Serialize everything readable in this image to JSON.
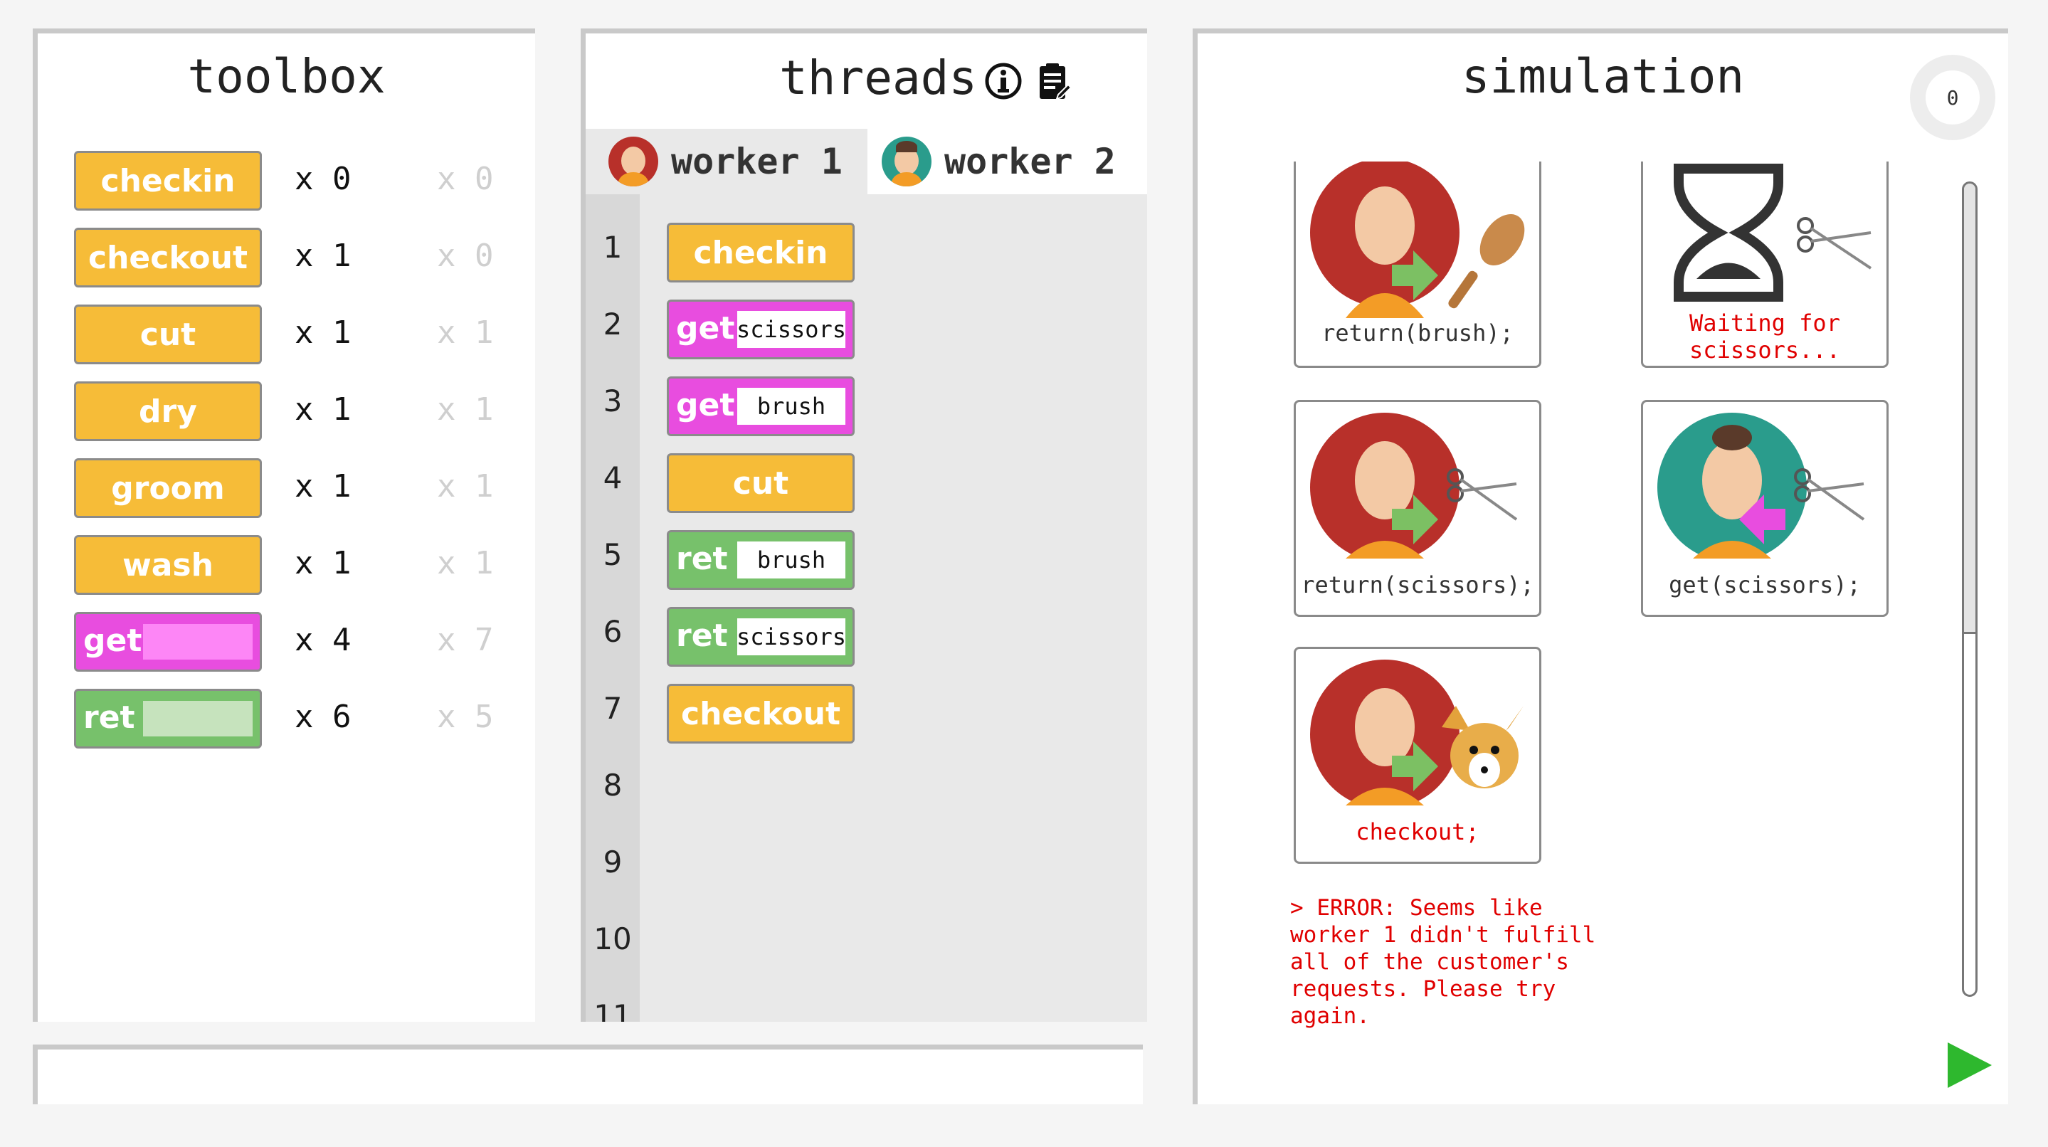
{
  "toolbox": {
    "title": "toolbox",
    "items": [
      {
        "label": "checkin",
        "kind": "yellow",
        "count": "x 0",
        "limit": "x 0"
      },
      {
        "label": "checkout",
        "kind": "yellow",
        "count": "x 1",
        "limit": "x 0"
      },
      {
        "label": "cut",
        "kind": "yellow",
        "count": "x 1",
        "limit": "x 1"
      },
      {
        "label": "dry",
        "kind": "yellow",
        "count": "x 1",
        "limit": "x 1"
      },
      {
        "label": "groom",
        "kind": "yellow",
        "count": "x 1",
        "limit": "x 1"
      },
      {
        "label": "wash",
        "kind": "yellow",
        "count": "x 1",
        "limit": "x 1"
      },
      {
        "label": "get",
        "kind": "magenta",
        "count": "x 4",
        "limit": "x 7"
      },
      {
        "label": "ret",
        "kind": "green",
        "count": "x 6",
        "limit": "x 5"
      }
    ]
  },
  "threads": {
    "title": "threads",
    "tabs": [
      {
        "label": "worker 1",
        "active": true
      },
      {
        "label": "worker 2",
        "active": false
      }
    ],
    "line_numbers": [
      "1",
      "2",
      "3",
      "4",
      "5",
      "6",
      "7",
      "8",
      "9",
      "10",
      "11"
    ],
    "code": [
      {
        "label": "checkin",
        "kind": "yellow"
      },
      {
        "label": "get",
        "kind": "magenta",
        "param": "scissors"
      },
      {
        "label": "get",
        "kind": "magenta",
        "param": "brush"
      },
      {
        "label": "cut",
        "kind": "yellow"
      },
      {
        "label": "ret",
        "kind": "green",
        "param": "brush"
      },
      {
        "label": "ret",
        "kind": "green",
        "param": "scissors"
      },
      {
        "label": "checkout",
        "kind": "yellow"
      }
    ]
  },
  "simulation": {
    "title": "simulation",
    "timer": "0",
    "cards": [
      {
        "caption": "return(brush);",
        "error": false
      },
      {
        "caption": "Waiting for\nscissors...",
        "error": true
      },
      {
        "caption": "return(scissors);",
        "error": false
      },
      {
        "caption": "get(scissors);",
        "error": false
      },
      {
        "caption": "checkout;",
        "error": true
      }
    ],
    "error_message": "> ERROR: Seems like\nworker 1 didn't fulfill\nall of the customer's\nrequests. Please try\nagain."
  },
  "colors": {
    "yellow_block": "#f6bc38",
    "magenta_block": "#e84ddf",
    "green_block": "#77c16b",
    "error_red": "#e00000",
    "play_green": "#2eb82e"
  },
  "icons": {
    "threads_info": "info-icon",
    "threads_clipboard": "clipboard-icon",
    "run": "play-icon"
  }
}
